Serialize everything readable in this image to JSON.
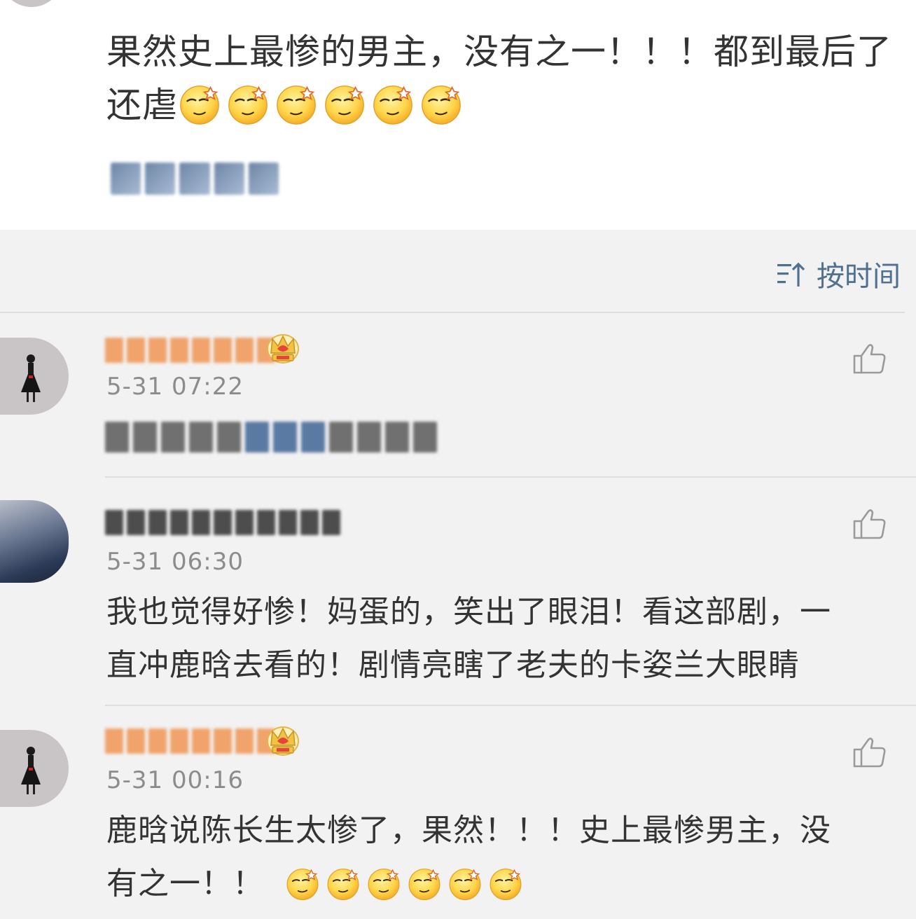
{
  "post": {
    "line1": "果然史上最惨的男主，没有之一！！！都到最后了",
    "line2_text": "还虐",
    "emoji_icon": "sleepy-smirk-emoji",
    "emoji_count": 6
  },
  "sort": {
    "label": "按时间",
    "icon": "sort-ascending-icon",
    "color": "#50708f"
  },
  "comments": [
    {
      "username_style": "orange-blurred",
      "badge_icon": "crown-icon",
      "time": "5-31 07:22",
      "like_icon": "thumbs-up-icon"
    },
    {
      "username_style": "dark-blurred",
      "time": "5-31 06:30",
      "text_line1": "我也觉得好惨！妈蛋的，笑出了眼泪！看这部剧，一",
      "text_line2": "直冲鹿晗去看的！剧情亮瞎了老夫的卡姿兰大眼睛",
      "like_icon": "thumbs-up-icon"
    },
    {
      "username_style": "orange-blurred",
      "badge_icon": "crown-icon",
      "time": "5-31 00:16",
      "text_line1": "鹿晗说陈长生太惨了，果然！！！史上最惨男主，没",
      "text_line2_text": "有之一！！",
      "emoji_icon": "sleepy-smirk-emoji",
      "emoji_count": 6,
      "like_icon": "thumbs-up-icon"
    }
  ],
  "colors": {
    "background": "#f2f2f2",
    "card": "#ffffff",
    "text": "#333333",
    "time": "#8c8c8c",
    "link": "#50708f"
  }
}
